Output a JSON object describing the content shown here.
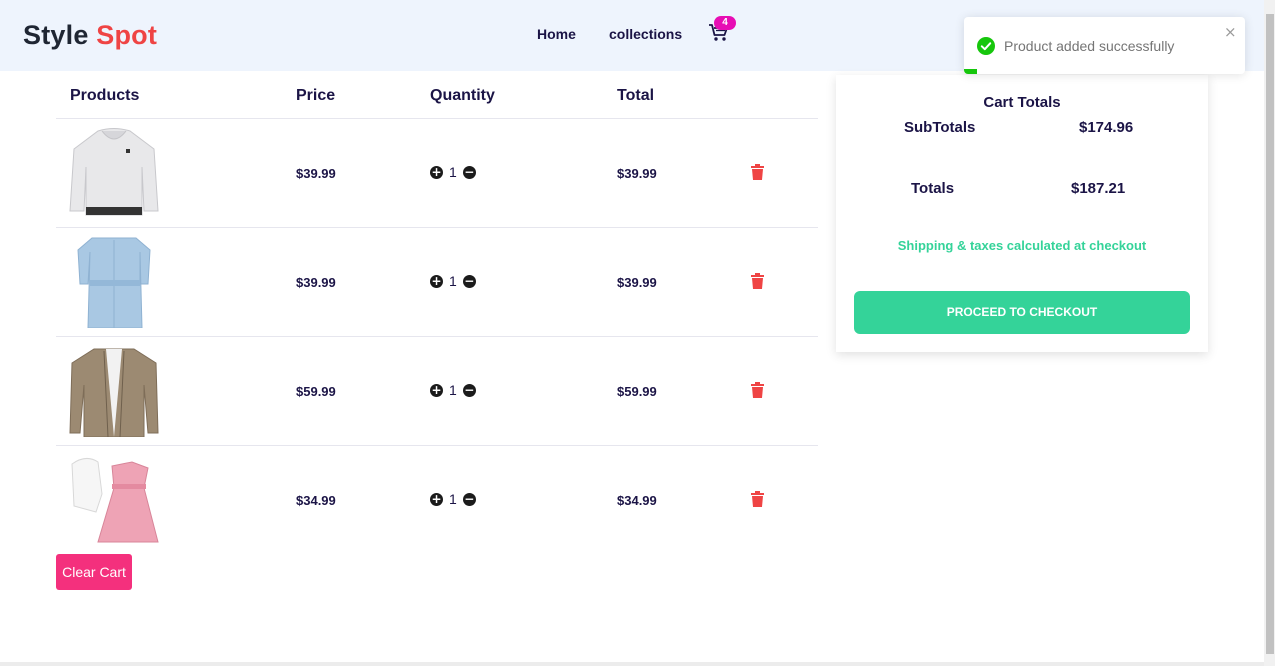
{
  "header": {
    "logo_part1": "Style",
    "logo_part2": "Spot",
    "nav_home": "Home",
    "nav_collections": "collections",
    "cart_icon": "shopping-cart-icon",
    "cart_count": "4"
  },
  "table": {
    "headers": {
      "products": "Products",
      "price": "Price",
      "quantity": "Quantity",
      "total": "Total"
    },
    "rows": [
      {
        "image": "white-hoodie",
        "price": "$39.99",
        "quantity": "1",
        "total": "$39.99"
      },
      {
        "image": "denim-shirt-dress",
        "price": "$39.99",
        "quantity": "1",
        "total": "$39.99"
      },
      {
        "image": "suede-jacket",
        "price": "$59.99",
        "quantity": "1",
        "total": "$59.99"
      },
      {
        "image": "pink-dress-with-cardigan",
        "price": "$34.99",
        "quantity": "1",
        "total": "$34.99"
      }
    ],
    "clear_cart_label": "Clear Cart"
  },
  "cart_totals": {
    "title": "Cart Totals",
    "subtotal_label": "SubTotals",
    "subtotal_value": "$174.96",
    "total_label": "Totals",
    "total_value": "$187.21",
    "shipping_note": "Shipping & taxes calculated at checkout",
    "checkout_label": "PROCEED TO CHECKOUT"
  },
  "toast": {
    "message": "Product added successfully",
    "icon": "check-circle-icon",
    "close_glyph": "×"
  },
  "colors": {
    "accent_red": "#ef4444",
    "badge": "#e70db4",
    "clear_button": "#f4307d",
    "checkout": "#34d399",
    "header_bg": "#eef4fd",
    "text_navy": "#1b1446"
  }
}
